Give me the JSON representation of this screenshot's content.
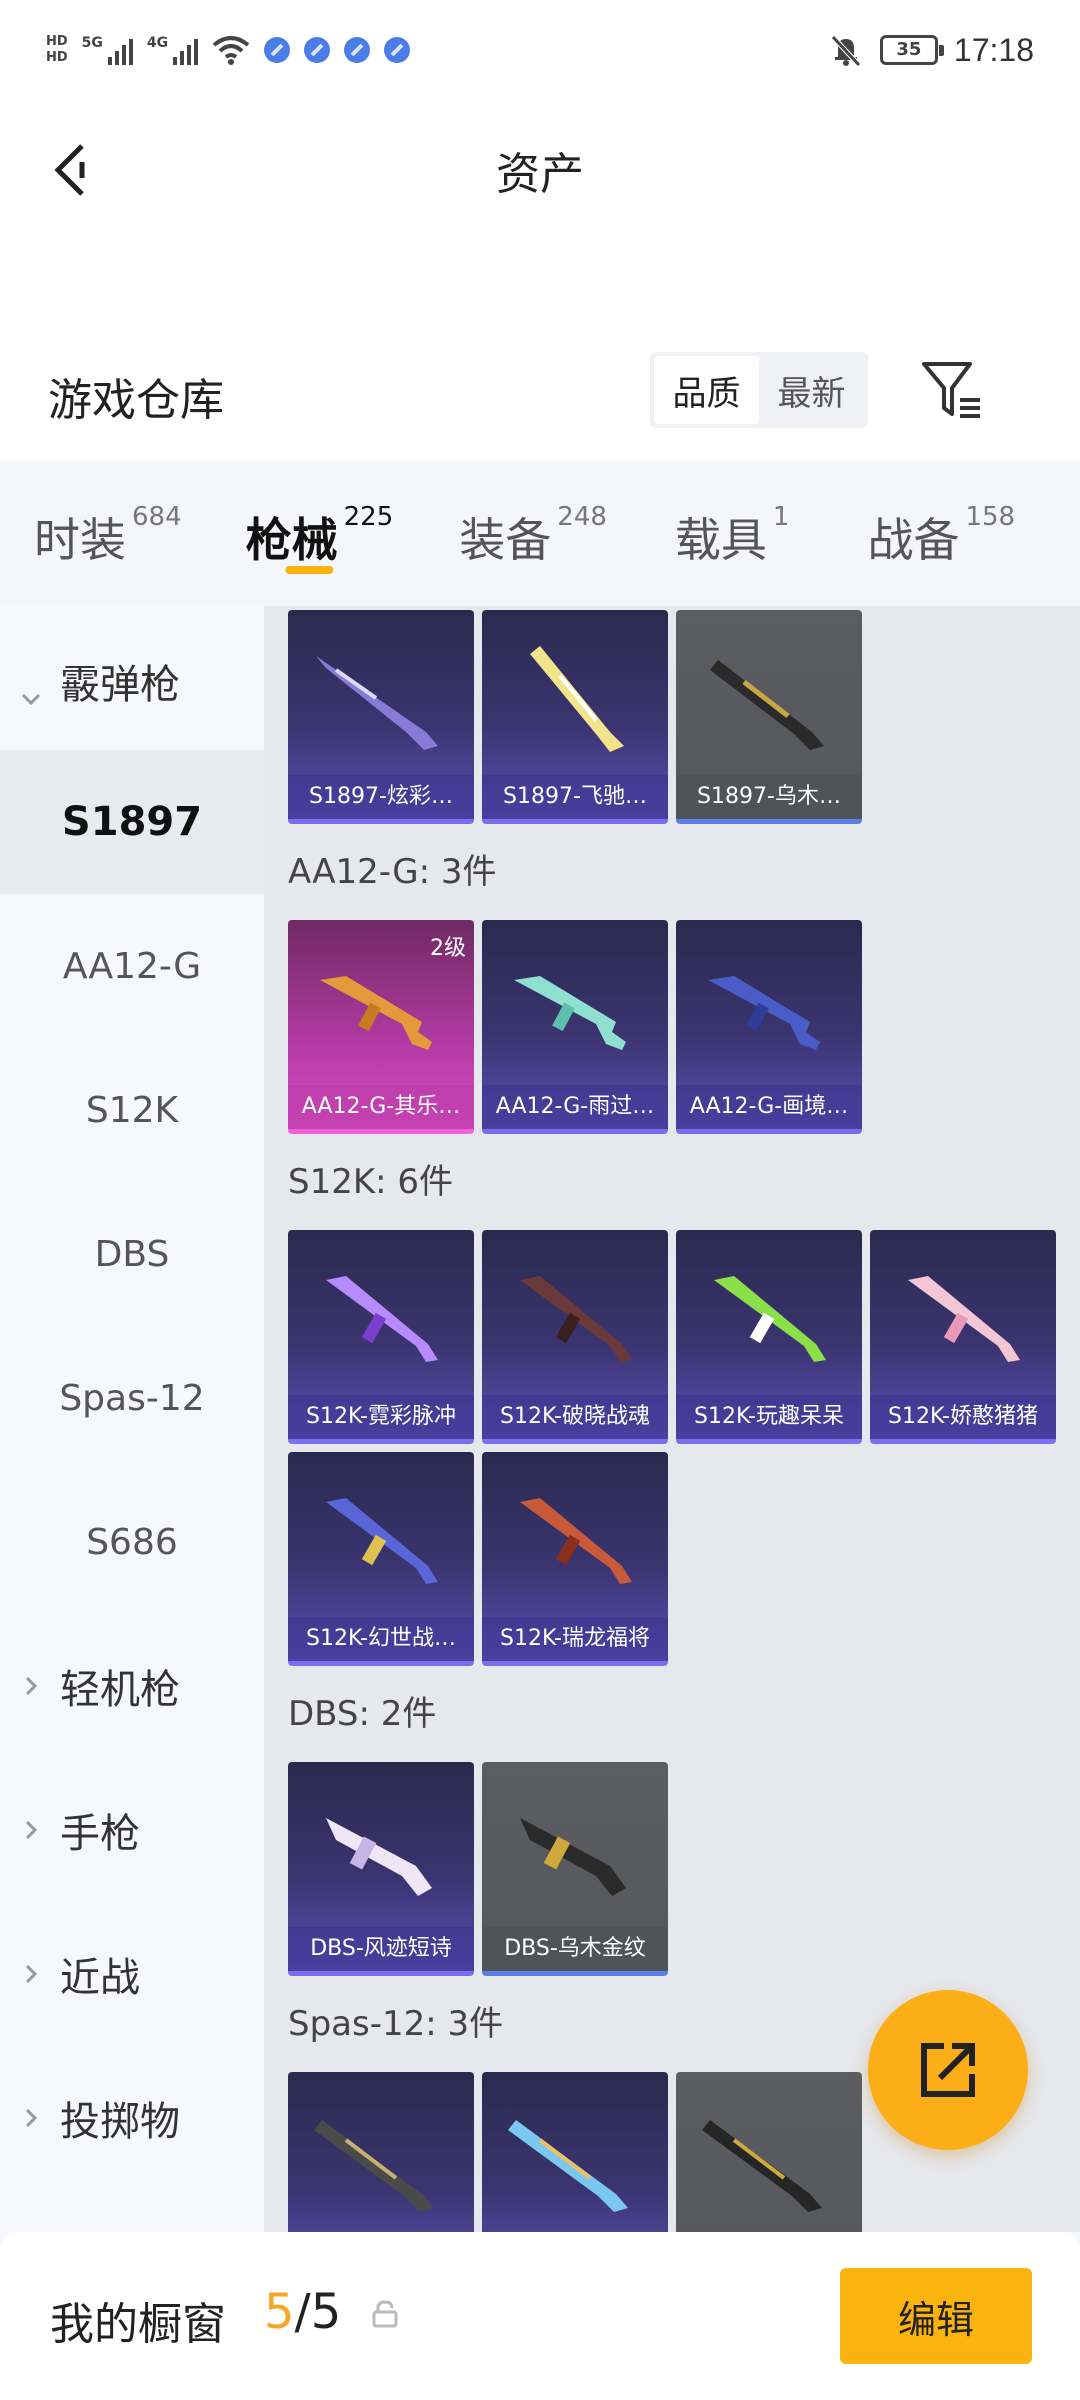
{
  "status_bar": {
    "hd1": "HD",
    "hd2": "HD",
    "net1": "5G",
    "net2": "4G",
    "battery": "35",
    "time": "17:18",
    "icons": [
      "hd-icon",
      "signal-5g-icon",
      "signal-4g-icon",
      "wifi-icon",
      "app-notification-icon",
      "app-notification-icon",
      "app-notification-icon",
      "app-notification-icon",
      "mute-bell-icon",
      "battery-icon"
    ]
  },
  "header": {
    "title": "资产",
    "back_icon": "chevron-left-icon"
  },
  "warehouse": {
    "title": "游戏仓库",
    "sort_options": [
      "品质",
      "最新"
    ],
    "sort_selected": "品质",
    "filter_icon": "filter-list-icon"
  },
  "tabs": [
    {
      "label": "时装",
      "count": "684"
    },
    {
      "label": "枪械",
      "count": "225",
      "active": true
    },
    {
      "label": "装备",
      "count": "248"
    },
    {
      "label": "载具",
      "count": "1"
    },
    {
      "label": "战备",
      "count": "158"
    }
  ],
  "sidebar": {
    "group_open": "霰弹枪",
    "items": [
      "S1897",
      "AA12-G",
      "S12K",
      "DBS",
      "Spas-12",
      "S686"
    ],
    "active_item": "S1897",
    "groups_closed": [
      "轻机枪",
      "手枪",
      "近战",
      "投掷物"
    ]
  },
  "sections": {
    "s1897": {
      "cards": [
        {
          "name": "S1897-炫彩…"
        },
        {
          "name": "S1897-飞驰…"
        },
        {
          "name": "S1897-乌木…"
        }
      ]
    },
    "aa12": {
      "title": "AA12-G: 3件",
      "cards": [
        {
          "name": "AA12-G-其乐…",
          "level": "2级"
        },
        {
          "name": "AA12-G-雨过…"
        },
        {
          "name": "AA12-G-画境…"
        }
      ]
    },
    "s12k": {
      "title": "S12K: 6件",
      "cards": [
        {
          "name": "S12K-霓彩脉冲"
        },
        {
          "name": "S12K-破晓战魂"
        },
        {
          "name": "S12K-玩趣呆呆"
        },
        {
          "name": "S12K-娇憨猪猪"
        },
        {
          "name": "S12K-幻世战…"
        },
        {
          "name": "S12K-瑞龙福将"
        }
      ]
    },
    "dbs": {
      "title": "DBS: 2件",
      "cards": [
        {
          "name": "DBS-风迹短诗"
        },
        {
          "name": "DBS-乌木金纹"
        }
      ]
    },
    "spas": {
      "title": "Spas-12: 3件"
    }
  },
  "fab": {
    "icon": "share-export-icon"
  },
  "bottom": {
    "title": "我的橱窗",
    "current": "5",
    "total": "/5",
    "lock_icon": "lock-icon",
    "edit_label": "编辑"
  },
  "colors": {
    "accent": "#fbb30d",
    "count_highlight": "#f5a623",
    "card_purple": "#3b3470",
    "card_gray": "#55575c",
    "card_pink": "#b43aa4"
  }
}
